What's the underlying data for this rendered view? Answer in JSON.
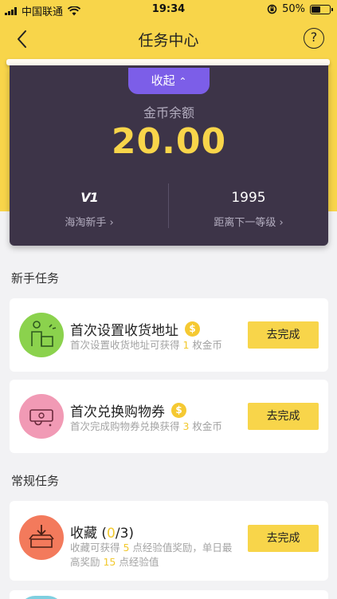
{
  "status_bar": {
    "carrier": "中国联通",
    "time": "19:34",
    "battery_percent": "50%"
  },
  "nav": {
    "title": "任务中心",
    "help_label": "?"
  },
  "balance": {
    "collapse_label": "收起",
    "label": "金币余额",
    "amount": "20.00",
    "level_value": "V1",
    "level_label": "海淘新手",
    "points_value": "1995",
    "points_label": "距离下一等级"
  },
  "sections": {
    "newbie_title": "新手任务",
    "regular_title": "常规任务"
  },
  "tasks": [
    {
      "title": "首次设置收货地址",
      "desc_prefix": "首次设置收货地址可获得 ",
      "desc_num": "1",
      "desc_suffix": " 枚金币",
      "button": "去完成",
      "icon": "address-person-icon",
      "icon_color": "#8bd24d"
    },
    {
      "title": "首次兑换购物券",
      "desc_prefix": "首次完成购物券兑换获得 ",
      "desc_num": "3",
      "desc_suffix": " 枚金币",
      "button": "去完成",
      "icon": "voucher-icon",
      "icon_color": "#f19ab5"
    },
    {
      "title_prefix": "收藏 (",
      "title_count": "0",
      "title_suffix": "/3)",
      "desc_a": "收藏可获得 ",
      "desc_n1": "5",
      "desc_b": " 点经验值奖励，单日最高奖励 ",
      "desc_n2": "15",
      "desc_c": " 点经验值",
      "button": "去完成",
      "icon": "favorite-box-icon",
      "icon_color": "#f37a5c"
    }
  ],
  "colors": {
    "yellow": "#f8d54a",
    "dark_card": "#3d3448",
    "purple": "#7c5ee8"
  }
}
